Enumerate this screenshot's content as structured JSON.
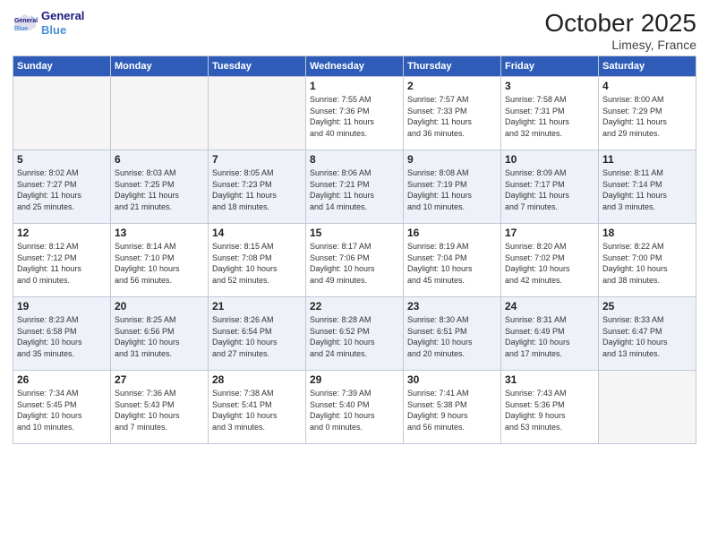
{
  "logo": {
    "line1": "General",
    "line2": "Blue"
  },
  "title": "October 2025",
  "location": "Limesy, France",
  "weekdays": [
    "Sunday",
    "Monday",
    "Tuesday",
    "Wednesday",
    "Thursday",
    "Friday",
    "Saturday"
  ],
  "weeks": [
    [
      {
        "day": "",
        "info": ""
      },
      {
        "day": "",
        "info": ""
      },
      {
        "day": "",
        "info": ""
      },
      {
        "day": "1",
        "info": "Sunrise: 7:55 AM\nSunset: 7:36 PM\nDaylight: 11 hours\nand 40 minutes."
      },
      {
        "day": "2",
        "info": "Sunrise: 7:57 AM\nSunset: 7:33 PM\nDaylight: 11 hours\nand 36 minutes."
      },
      {
        "day": "3",
        "info": "Sunrise: 7:58 AM\nSunset: 7:31 PM\nDaylight: 11 hours\nand 32 minutes."
      },
      {
        "day": "4",
        "info": "Sunrise: 8:00 AM\nSunset: 7:29 PM\nDaylight: 11 hours\nand 29 minutes."
      }
    ],
    [
      {
        "day": "5",
        "info": "Sunrise: 8:02 AM\nSunset: 7:27 PM\nDaylight: 11 hours\nand 25 minutes."
      },
      {
        "day": "6",
        "info": "Sunrise: 8:03 AM\nSunset: 7:25 PM\nDaylight: 11 hours\nand 21 minutes."
      },
      {
        "day": "7",
        "info": "Sunrise: 8:05 AM\nSunset: 7:23 PM\nDaylight: 11 hours\nand 18 minutes."
      },
      {
        "day": "8",
        "info": "Sunrise: 8:06 AM\nSunset: 7:21 PM\nDaylight: 11 hours\nand 14 minutes."
      },
      {
        "day": "9",
        "info": "Sunrise: 8:08 AM\nSunset: 7:19 PM\nDaylight: 11 hours\nand 10 minutes."
      },
      {
        "day": "10",
        "info": "Sunrise: 8:09 AM\nSunset: 7:17 PM\nDaylight: 11 hours\nand 7 minutes."
      },
      {
        "day": "11",
        "info": "Sunrise: 8:11 AM\nSunset: 7:14 PM\nDaylight: 11 hours\nand 3 minutes."
      }
    ],
    [
      {
        "day": "12",
        "info": "Sunrise: 8:12 AM\nSunset: 7:12 PM\nDaylight: 11 hours\nand 0 minutes."
      },
      {
        "day": "13",
        "info": "Sunrise: 8:14 AM\nSunset: 7:10 PM\nDaylight: 10 hours\nand 56 minutes."
      },
      {
        "day": "14",
        "info": "Sunrise: 8:15 AM\nSunset: 7:08 PM\nDaylight: 10 hours\nand 52 minutes."
      },
      {
        "day": "15",
        "info": "Sunrise: 8:17 AM\nSunset: 7:06 PM\nDaylight: 10 hours\nand 49 minutes."
      },
      {
        "day": "16",
        "info": "Sunrise: 8:19 AM\nSunset: 7:04 PM\nDaylight: 10 hours\nand 45 minutes."
      },
      {
        "day": "17",
        "info": "Sunrise: 8:20 AM\nSunset: 7:02 PM\nDaylight: 10 hours\nand 42 minutes."
      },
      {
        "day": "18",
        "info": "Sunrise: 8:22 AM\nSunset: 7:00 PM\nDaylight: 10 hours\nand 38 minutes."
      }
    ],
    [
      {
        "day": "19",
        "info": "Sunrise: 8:23 AM\nSunset: 6:58 PM\nDaylight: 10 hours\nand 35 minutes."
      },
      {
        "day": "20",
        "info": "Sunrise: 8:25 AM\nSunset: 6:56 PM\nDaylight: 10 hours\nand 31 minutes."
      },
      {
        "day": "21",
        "info": "Sunrise: 8:26 AM\nSunset: 6:54 PM\nDaylight: 10 hours\nand 27 minutes."
      },
      {
        "day": "22",
        "info": "Sunrise: 8:28 AM\nSunset: 6:52 PM\nDaylight: 10 hours\nand 24 minutes."
      },
      {
        "day": "23",
        "info": "Sunrise: 8:30 AM\nSunset: 6:51 PM\nDaylight: 10 hours\nand 20 minutes."
      },
      {
        "day": "24",
        "info": "Sunrise: 8:31 AM\nSunset: 6:49 PM\nDaylight: 10 hours\nand 17 minutes."
      },
      {
        "day": "25",
        "info": "Sunrise: 8:33 AM\nSunset: 6:47 PM\nDaylight: 10 hours\nand 13 minutes."
      }
    ],
    [
      {
        "day": "26",
        "info": "Sunrise: 7:34 AM\nSunset: 5:45 PM\nDaylight: 10 hours\nand 10 minutes."
      },
      {
        "day": "27",
        "info": "Sunrise: 7:36 AM\nSunset: 5:43 PM\nDaylight: 10 hours\nand 7 minutes."
      },
      {
        "day": "28",
        "info": "Sunrise: 7:38 AM\nSunset: 5:41 PM\nDaylight: 10 hours\nand 3 minutes."
      },
      {
        "day": "29",
        "info": "Sunrise: 7:39 AM\nSunset: 5:40 PM\nDaylight: 10 hours\nand 0 minutes."
      },
      {
        "day": "30",
        "info": "Sunrise: 7:41 AM\nSunset: 5:38 PM\nDaylight: 9 hours\nand 56 minutes."
      },
      {
        "day": "31",
        "info": "Sunrise: 7:43 AM\nSunset: 5:36 PM\nDaylight: 9 hours\nand 53 minutes."
      },
      {
        "day": "",
        "info": ""
      }
    ]
  ]
}
